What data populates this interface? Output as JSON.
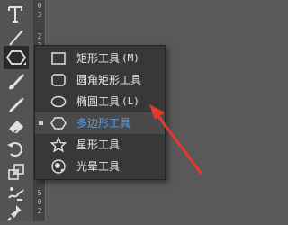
{
  "ruler": {
    "ticks": [
      "0",
      "3",
      "2",
      "3",
      "0",
      "0",
      "5",
      "0",
      "2"
    ]
  },
  "tools": [
    {
      "name": "type-tool",
      "icon": "text-T-icon"
    },
    {
      "name": "line-tool",
      "icon": "line-icon"
    },
    {
      "name": "polygon-tool",
      "icon": "hexagon-icon"
    },
    {
      "name": "paintbrush-tool",
      "icon": "brush-icon"
    },
    {
      "name": "pencil-tool",
      "icon": "pencil-icon"
    },
    {
      "name": "eraser-tool",
      "icon": "eraser-icon"
    },
    {
      "name": "rotate-tool",
      "icon": "rotate-icon"
    },
    {
      "name": "scale-tool",
      "icon": "scale-icon"
    },
    {
      "name": "puppet-warp-tool",
      "icon": "warp-icon"
    },
    {
      "name": "pin-tool",
      "icon": "pin-icon"
    }
  ],
  "flyout": {
    "items": [
      {
        "label": "矩形工具",
        "shortcut": "(M)",
        "icon": "rectangle-icon",
        "selected": false
      },
      {
        "label": "圆角矩形工具",
        "shortcut": "",
        "icon": "rounded-rectangle-icon",
        "selected": false
      },
      {
        "label": "椭圆工具",
        "shortcut": "(L)",
        "icon": "ellipse-icon",
        "selected": false
      },
      {
        "label": "多边形工具",
        "shortcut": "",
        "icon": "polygon-icon",
        "selected": true
      },
      {
        "label": "星形工具",
        "shortcut": "",
        "icon": "star-icon",
        "selected": false
      },
      {
        "label": "光晕工具",
        "shortcut": "",
        "icon": "flare-icon",
        "selected": false
      }
    ]
  },
  "colors": {
    "selected_text": "#4a9ff2",
    "arrow": "#e8372f"
  }
}
